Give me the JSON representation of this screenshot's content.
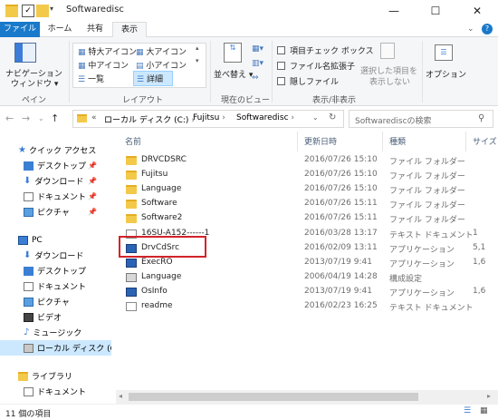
{
  "window": {
    "title": "Softwaredisc",
    "minimize": "—",
    "maximize": "☐",
    "close": "✕"
  },
  "ribbon_tabs": [
    "ファイル",
    "ホーム",
    "共有",
    "表示"
  ],
  "ribbon": {
    "nav_pane": "ナビゲーション\nウィンドウ",
    "nav_pane_l1": "ナビゲーション",
    "nav_pane_l2": "ウィンドウ ▾",
    "pane_group": "ペイン",
    "layout_group": "レイアウト",
    "layout_items": [
      "特大アイコン",
      "大アイコン",
      "中アイコン",
      "小アイコン",
      "一覧",
      "詳細"
    ],
    "sort_by": "並べ替え",
    "current_view_group": "現在のビュー",
    "item_checkbox": "項目チェック ボックス",
    "file_extensions": "ファイル名拡張子",
    "hidden_files": "隠しファイル",
    "hide_selected_l1": "選択した項目を",
    "hide_selected_l2": "表示しない",
    "options": "オプション",
    "show_hide_group": "表示/非表示"
  },
  "address": {
    "path": [
      "«",
      "ローカル ディスク (C:)",
      "Fujitsu",
      "Softwaredisc"
    ],
    "search_placeholder": "Softwarediscの検索"
  },
  "nav": [
    {
      "label": "クイック アクセス",
      "pin": ""
    },
    {
      "label": "デスクトップ",
      "pin": "📌"
    },
    {
      "label": "ダウンロード",
      "pin": "📌"
    },
    {
      "label": "ドキュメント",
      "pin": "📌"
    },
    {
      "label": "ピクチャ",
      "pin": "📌"
    },
    {
      "label": "PC",
      "pin": ""
    },
    {
      "label": "ダウンロード",
      "pin": ""
    },
    {
      "label": "デスクトップ",
      "pin": ""
    },
    {
      "label": "ドキュメント",
      "pin": ""
    },
    {
      "label": "ピクチャ",
      "pin": ""
    },
    {
      "label": "ビデオ",
      "pin": ""
    },
    {
      "label": "ミュージック",
      "pin": ""
    },
    {
      "label": "ローカル ディスク (C",
      "pin": ""
    },
    {
      "label": "ライブラリ",
      "pin": ""
    },
    {
      "label": "ドキュメント",
      "pin": ""
    }
  ],
  "columns": {
    "name": "名前",
    "date": "更新日時",
    "type": "種類",
    "size": "サイズ"
  },
  "files": [
    {
      "name": "DRVCDSRC",
      "date": "2016/07/26 15:10",
      "type": "ファイル フォルダー",
      "size": "",
      "icon": "folder"
    },
    {
      "name": "Fujitsu",
      "date": "2016/07/26 15:10",
      "type": "ファイル フォルダー",
      "size": "",
      "icon": "folder"
    },
    {
      "name": "Language",
      "date": "2016/07/26 15:10",
      "type": "ファイル フォルダー",
      "size": "",
      "icon": "folder"
    },
    {
      "name": "Software",
      "date": "2016/07/26 15:11",
      "type": "ファイル フォルダー",
      "size": "",
      "icon": "folder"
    },
    {
      "name": "Software2",
      "date": "2016/07/26 15:11",
      "type": "ファイル フォルダー",
      "size": "",
      "icon": "folder"
    },
    {
      "name": "16SU-A152------1",
      "date": "2016/03/28 13:17",
      "type": "テキスト ドキュメント",
      "size": "1",
      "icon": "doc"
    },
    {
      "name": "DrvCdSrc",
      "date": "2016/02/09 13:11",
      "type": "アプリケーション",
      "size": "5,1",
      "icon": "app"
    },
    {
      "name": "ExecRO",
      "date": "2013/07/19 9:41",
      "type": "アプリケーション",
      "size": "1,6",
      "icon": "app"
    },
    {
      "name": "Language",
      "date": "2006/04/19 14:28",
      "type": "構成設定",
      "size": "",
      "icon": "cfg"
    },
    {
      "name": "OsInfo",
      "date": "2013/07/19 9:41",
      "type": "アプリケーション",
      "size": "1,6",
      "icon": "app"
    },
    {
      "name": "readme",
      "date": "2016/02/23 16:25",
      "type": "テキスト ドキュメント",
      "size": "",
      "icon": "doc"
    }
  ],
  "status": {
    "count": "11 個の項目"
  }
}
